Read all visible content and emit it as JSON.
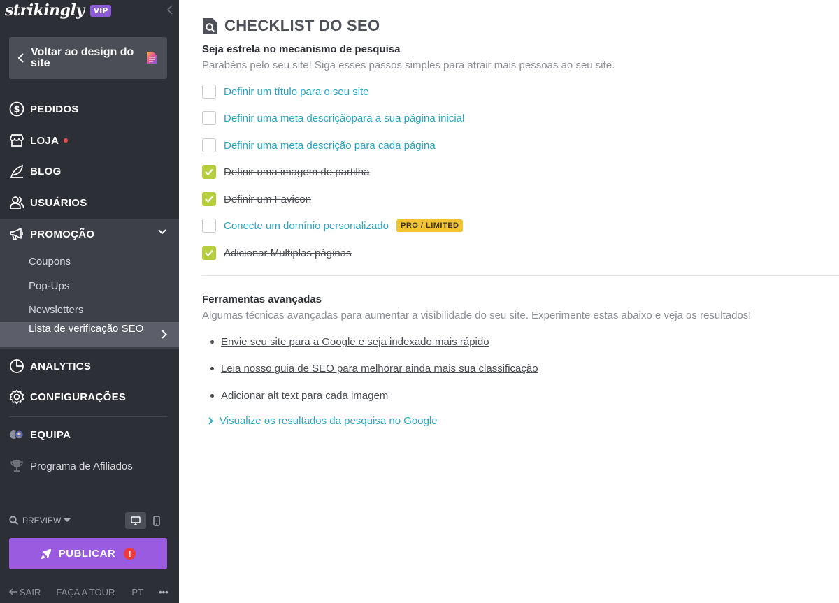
{
  "sidebar": {
    "logo": "strikingly",
    "vip_badge": "VIP",
    "back_button": "Voltar ao design do site",
    "nav": {
      "pedidos": "PEDIDOS",
      "loja": "LOJA",
      "blog": "BLOG",
      "usuarios": "USUÁRIOS",
      "promocao": "PROMOÇÃO",
      "analytics": "ANALYTICS",
      "configuracoes": "CONFIGURAÇÕES",
      "equipa": "EQUIPA",
      "afiliados": "Programa de Afiliados"
    },
    "promo_sub": {
      "coupons": "Coupons",
      "popups": "Pop-Ups",
      "newsletters": "Newsletters",
      "checklist": "Lista de verificação SEO"
    },
    "preview_label": "PREVIEW",
    "publish_label": "PUBLICAR",
    "publish_alert": "!",
    "footer": {
      "sair": "SAIR",
      "tour": "FAÇA A TOUR",
      "lang": "PT",
      "more": "•••"
    },
    "colors": {
      "background": "#2d2f36",
      "publish": "#9b5be0",
      "vip": "#8c5ad6"
    }
  },
  "main": {
    "title": "CHECKLIST DO SEO",
    "intro_heading": "Seja estrela no mecanismo de pesquisa",
    "intro_text": "Parabéns pelo seu site! Siga esses passos simples para atrair mais pessoas ao seu site.",
    "checklist": [
      {
        "label": "Definir um título para o seu site",
        "done": false
      },
      {
        "label": "Definir uma meta descriçãopara a sua página inicial",
        "done": false
      },
      {
        "label": "Definir uma meta descrição para cada página",
        "done": false
      },
      {
        "label": "Definir uma imagem de partilha",
        "done": true
      },
      {
        "label": "Definir um Favicon",
        "done": true
      },
      {
        "label": "Conecte um domínio personalizado",
        "done": false,
        "badge": "PRO / LIMITED"
      },
      {
        "label": "Adicionar Multiplas páginas",
        "done": true
      }
    ],
    "advanced_heading": "Ferramentas avançadas",
    "advanced_text": "Algumas técnicas avançadas para aumentar a visibilidade do seu site. Experimente estas abaixo e veja os resultados!",
    "advanced_links": [
      "Envie seu site para a Google e seja indexado mais rápido",
      "Leia nosso guia de SEO para melhorar ainda mais sua classificação",
      "Adicionar alt text para cada imagem"
    ],
    "google_preview": "Visualize os resultados da pesquisa no Google",
    "colors": {
      "link": "#27a7c6",
      "check_done": "#b7cf3f",
      "badge": "#f3c431"
    }
  }
}
